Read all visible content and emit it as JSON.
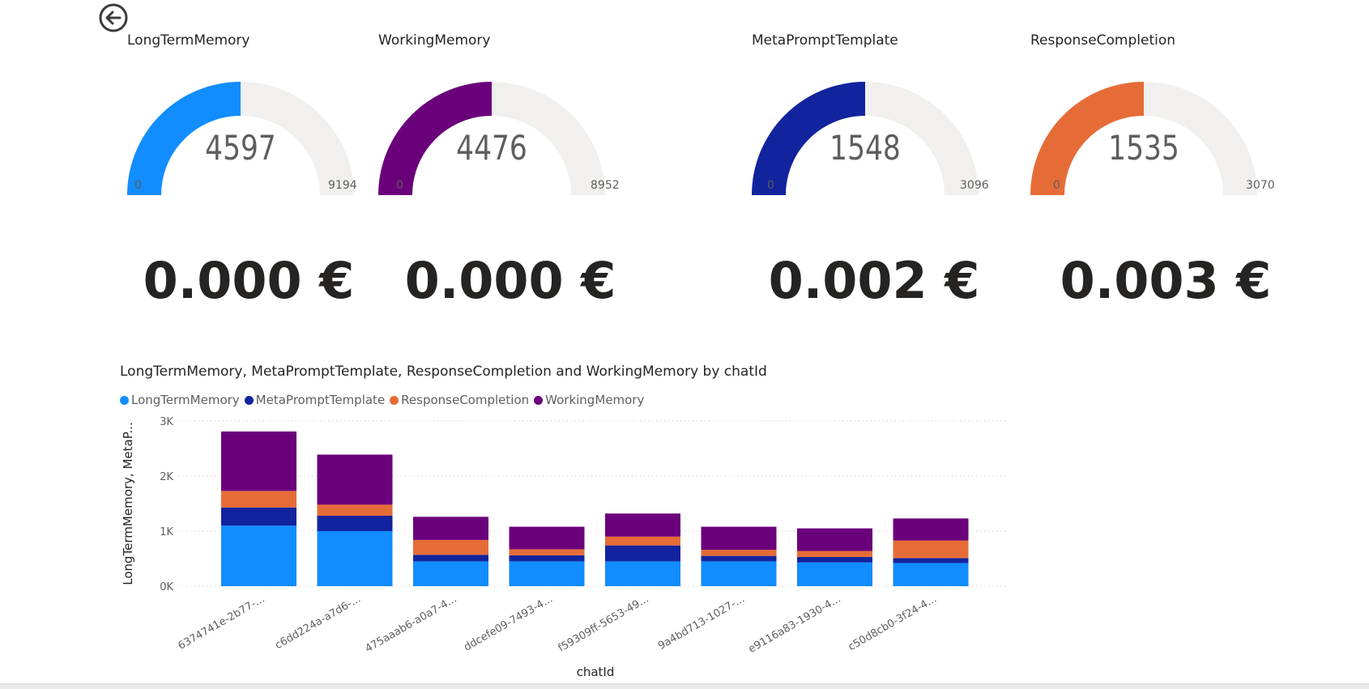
{
  "gauges": [
    {
      "title": "LongTermMemory",
      "value": "4597",
      "min": "0",
      "max": "9194",
      "fraction": 0.5,
      "color": "#118DFF"
    },
    {
      "title": "WorkingMemory",
      "value": "4476",
      "min": "0",
      "max": "8952",
      "fraction": 0.5,
      "color": "#6B007B"
    },
    {
      "title": "MetaPromptTemplate",
      "value": "1548",
      "min": "0",
      "max": "3096",
      "fraction": 0.5,
      "color": "#12239E"
    },
    {
      "title": "ResponseCompletion",
      "value": "1535",
      "min": "0",
      "max": "3070",
      "fraction": 0.5,
      "color": "#E66C37"
    }
  ],
  "cards": [
    "0.000 €",
    "0.000 €",
    "0.002 €",
    "0.003 €"
  ],
  "chart_data": {
    "type": "bar",
    "stacked": true,
    "title": "LongTermMemory, MetaPromptTemplate, ResponseCompletion and WorkingMemory by chatId",
    "xlabel": "chatId",
    "ylabel": "LongTermMemory, MetaP...",
    "ylim": [
      0,
      3000
    ],
    "yticks": [
      "0K",
      "1K",
      "2K",
      "3K"
    ],
    "grid": true,
    "legend_position": "top-left",
    "categories": [
      "6374741e-2b77-...",
      "c6dd224a-a7d6-...",
      "475aaab6-a0a7-4...",
      "ddcefe09-7493-4...",
      "f59309ff-5653-49...",
      "9a4bd713-1027-...",
      "e9116a83-1930-4...",
      "c50d8cb0-3f24-4..."
    ],
    "series": [
      {
        "name": "LongTermMemory",
        "color": "#118DFF",
        "values": [
          1100,
          1000,
          450,
          450,
          450,
          450,
          430,
          420
        ]
      },
      {
        "name": "MetaPromptTemplate",
        "color": "#12239E",
        "values": [
          330,
          280,
          120,
          110,
          290,
          100,
          100,
          90
        ]
      },
      {
        "name": "ResponseCompletion",
        "color": "#E66C37",
        "values": [
          300,
          200,
          270,
          110,
          160,
          110,
          110,
          320
        ]
      },
      {
        "name": "WorkingMemory",
        "color": "#6B007B",
        "values": [
          1080,
          910,
          420,
          410,
          420,
          420,
          410,
          400
        ]
      }
    ]
  }
}
